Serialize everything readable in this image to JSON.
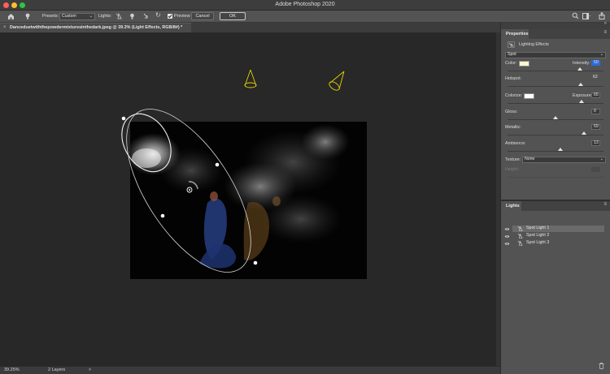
{
  "window": {
    "title": "Adobe Photoshop 2020"
  },
  "options_bar": {
    "presets_label": "Presets:",
    "presets_value": "Custom",
    "lights_label": "Lights:",
    "preview_label": "Preview",
    "preview_checked": true,
    "cancel_label": "Cancel",
    "ok_label": "OK"
  },
  "document": {
    "tab_title": "Danceduetwiththepowdermixturesinthedark.jpeg @ 39.3% (Light Effects, RGB/8#) *"
  },
  "status_bar": {
    "zoom": "39.25%",
    "layers": "2 Layers"
  },
  "properties": {
    "title": "Properties",
    "header": "Lighting Effects",
    "light_type": "Spot",
    "color_label": "Color:",
    "color_swatch": "#fff6cc",
    "intensity_label": "Intensity:",
    "intensity_value": "50",
    "intensity_level": 0.75,
    "hotspot_label": "Hotspot:",
    "hotspot_value": "62",
    "hotspot_level": 0.76,
    "colorize_label": "Colorize:",
    "colorize_swatch": "#ffffff",
    "exposure_label": "Exposure:",
    "exposure_value": "65",
    "exposure_level": 0.77,
    "gloss_label": "Gloss:",
    "gloss_value": "0",
    "gloss_level": 0.5,
    "metallic_label": "Metallic:",
    "metallic_value": "69",
    "metallic_level": 0.8,
    "ambience_label": "Ambience:",
    "ambience_value": "13",
    "ambience_level": 0.55,
    "texture_label": "Texture:",
    "texture_value": "None",
    "height_label": "Height:"
  },
  "lights_panel": {
    "title": "Lights",
    "items": [
      {
        "label": "Spot Light 1",
        "selected": true
      },
      {
        "label": "Spot Light 2",
        "selected": false
      },
      {
        "label": "Spot Light 3",
        "selected": false
      }
    ]
  },
  "colors": {
    "accent": "#2d6ad6",
    "spot_light_cone": "#e8d200",
    "close": "#fe5f57",
    "minimize": "#febc2e",
    "zoom": "#28c840"
  },
  "icons": [
    "home-icon",
    "light-bulb-icon",
    "spot-light-icon",
    "point-light-icon",
    "infinite-light-icon",
    "reset-icon",
    "search-icon",
    "workspace-icon",
    "share-icon",
    "eye-icon",
    "trash-icon"
  ]
}
